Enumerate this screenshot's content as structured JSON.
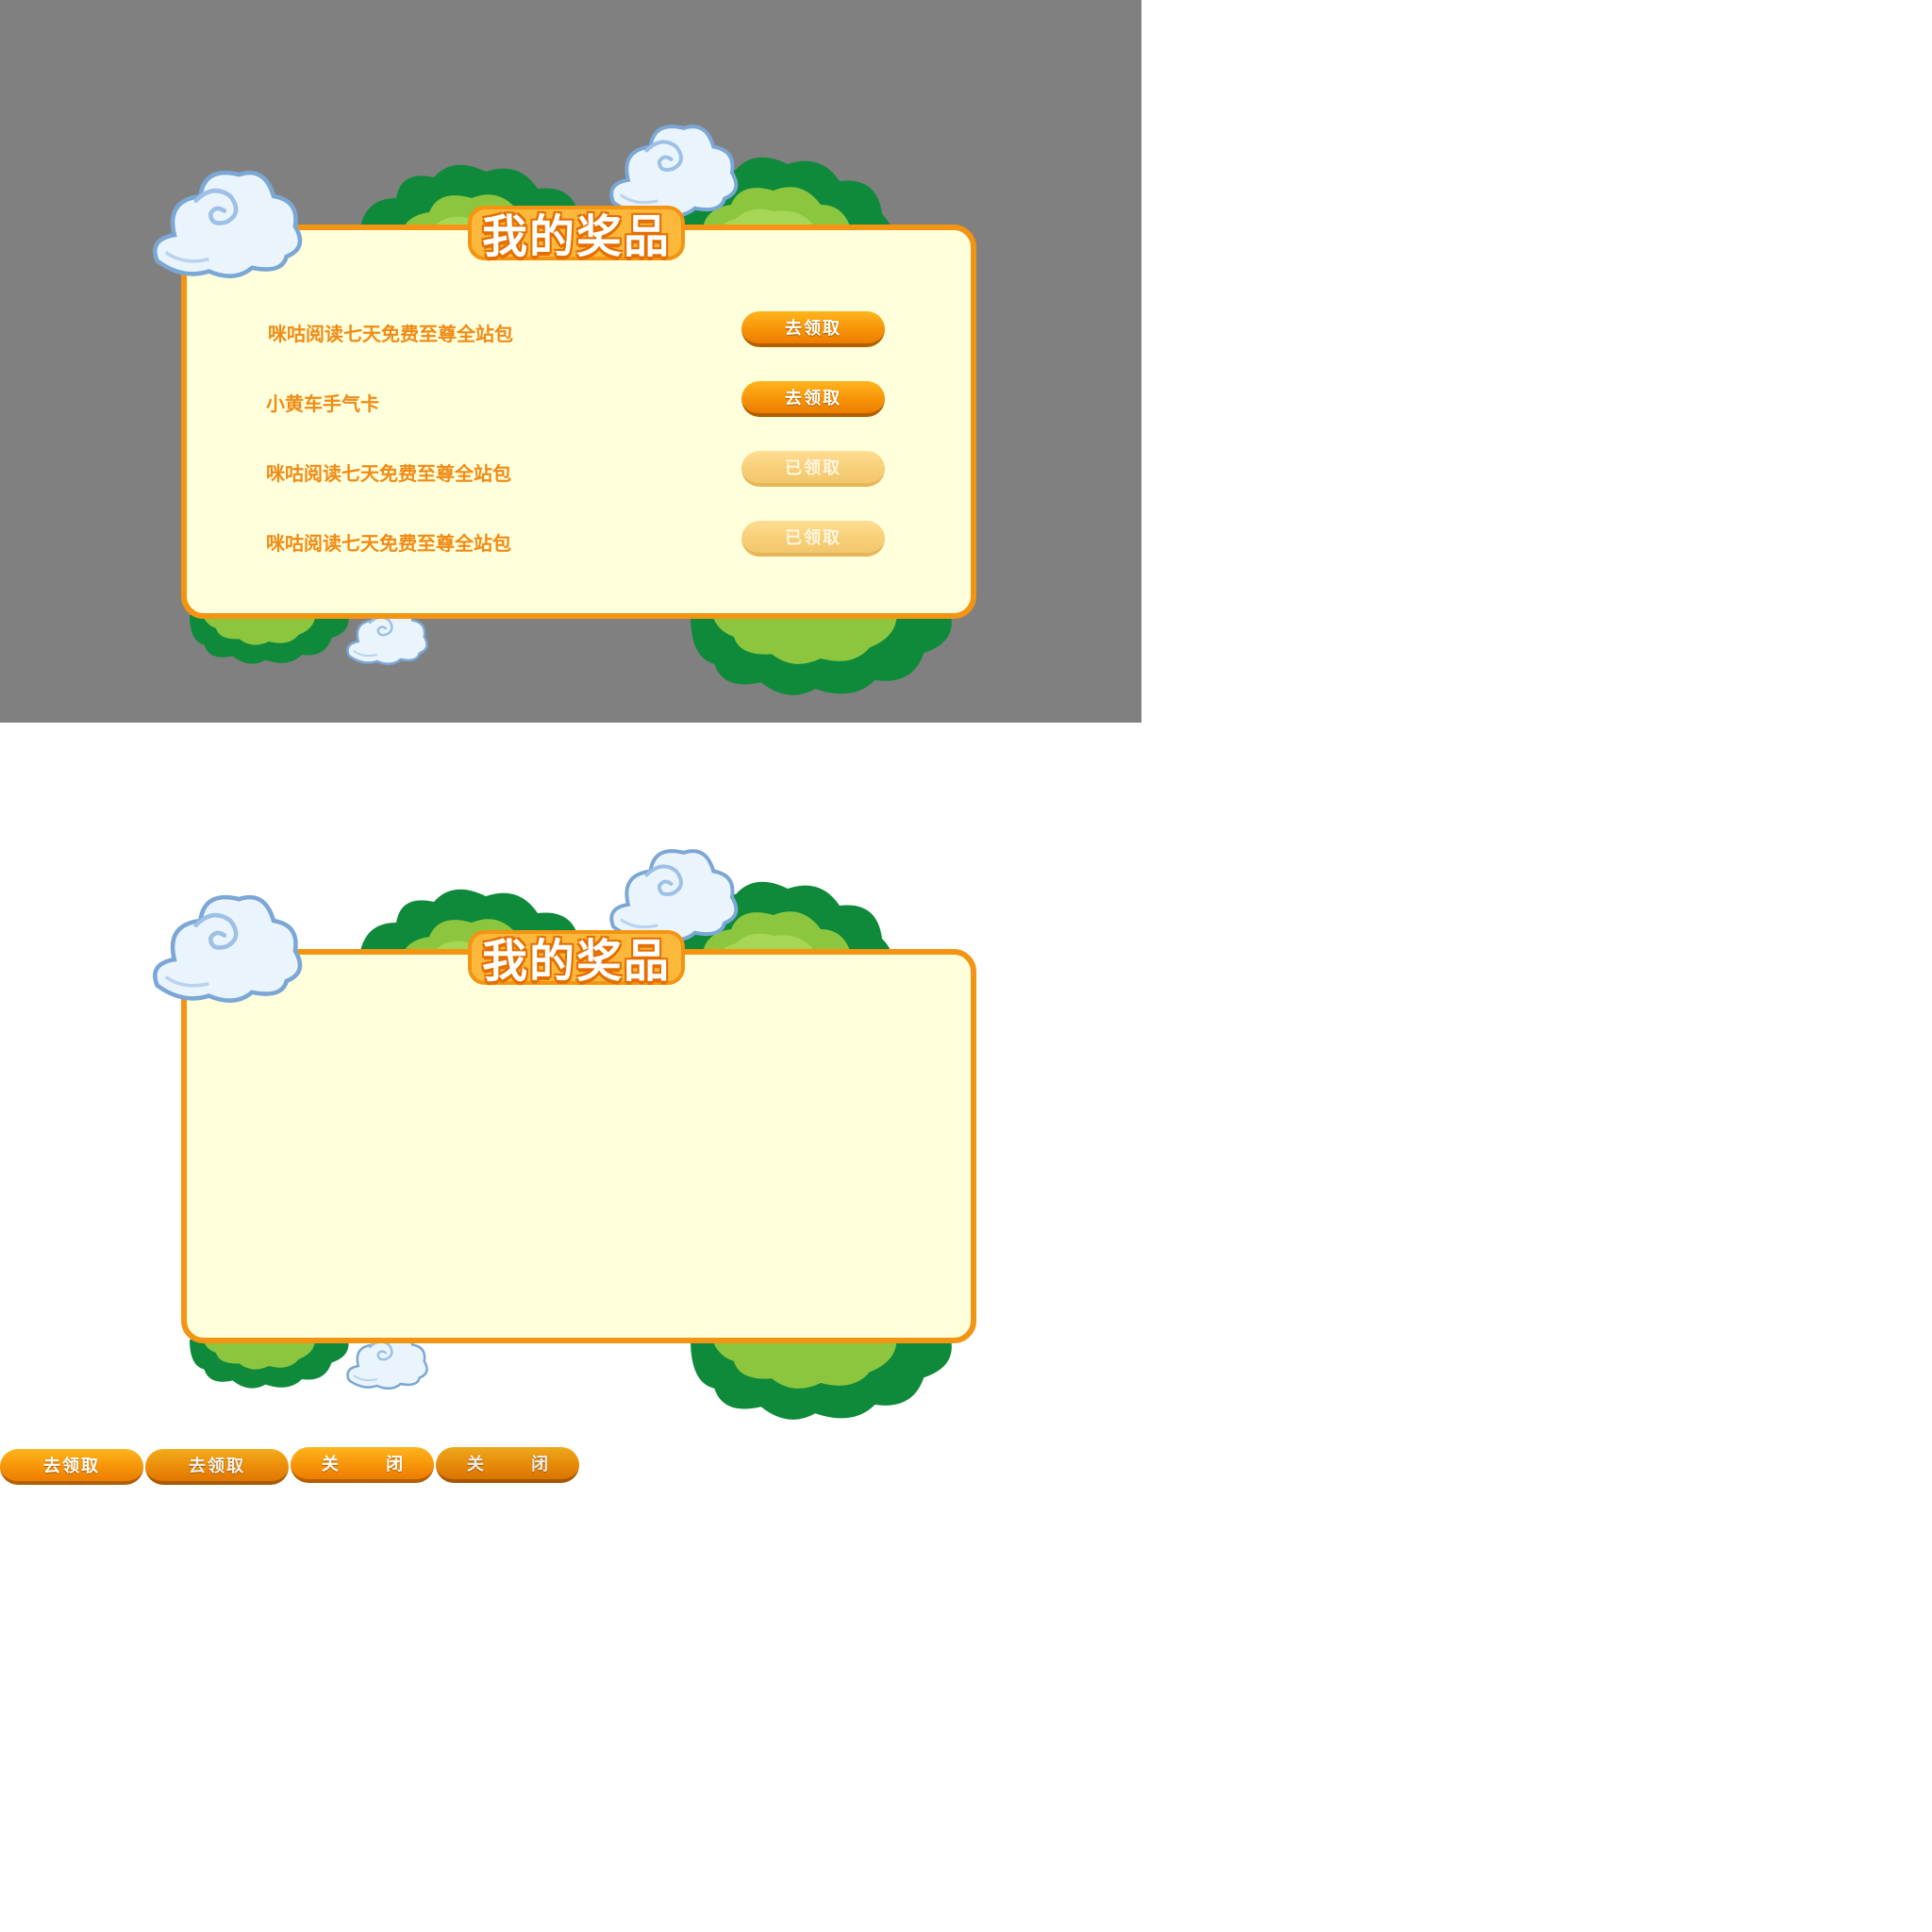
{
  "preview": {
    "title": "我的奖品",
    "prizes": [
      {
        "name": "咪咕阅读七天免费至尊全站包",
        "button_label": "去领取",
        "status": "claimable"
      },
      {
        "name": "小黄车手气卡",
        "button_label": "去领取",
        "status": "claimable"
      },
      {
        "name": "咪咕阅读七天免费至尊全站包",
        "button_label": "已领取",
        "status": "claimed"
      },
      {
        "name": "咪咕阅读七天免费至尊全站包",
        "button_label": "已领取",
        "status": "claimed"
      }
    ]
  },
  "empty_panel": {
    "title": "我的奖品"
  },
  "sprite_buttons": {
    "claim_normal": "去领取",
    "claim_pressed": "去领取",
    "close_normal": "关 闭",
    "close_pressed": "关 闭"
  },
  "colors": {
    "backdrop": "#808080",
    "panel_fill": "#ffffdc",
    "panel_border": "#f39412",
    "prize_text": "#f08b16",
    "button_orange": "#f99a0c",
    "button_claimed": "#f8d07a",
    "bush_dark": "#0e8a3a",
    "bush_light": "#8cc63f",
    "cloud": "#e9f3fb"
  }
}
